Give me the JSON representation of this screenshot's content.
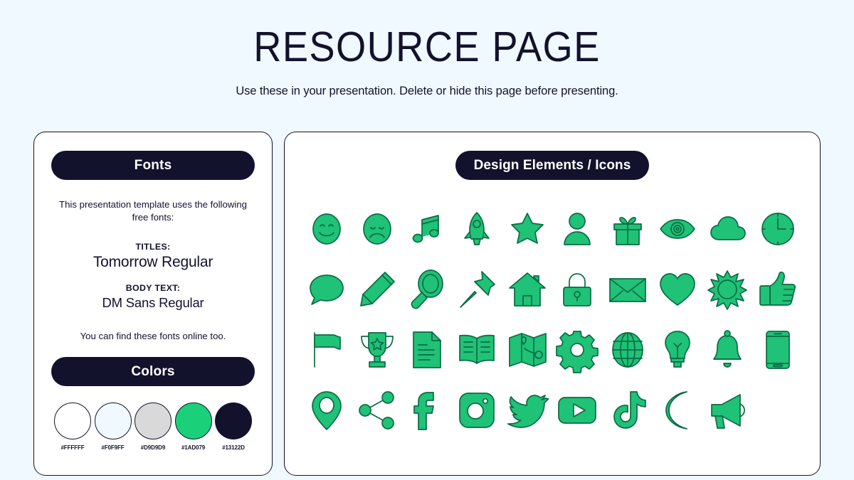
{
  "header": {
    "title": "RESOURCE PAGE",
    "subtitle": "Use these in your presentation. Delete or hide this page before presenting."
  },
  "fonts_panel": {
    "heading": "Fonts",
    "intro": "This presentation template uses the following free fonts:",
    "titles_label": "TITLES:",
    "titles_font": "Tomorrow Regular",
    "body_label": "BODY TEXT:",
    "body_font": "DM Sans Regular",
    "outro": "You can find these fonts online too."
  },
  "colors_panel": {
    "heading": "Colors",
    "swatches": [
      {
        "hex": "#FFFFFF",
        "label": "#FFFFFF",
        "bordered": true
      },
      {
        "hex": "#F0F9FF",
        "label": "#F0F9FF",
        "bordered": true
      },
      {
        "hex": "#D9D9D9",
        "label": "#D9D9D9",
        "bordered": true
      },
      {
        "hex": "#1AD079",
        "label": "#1AD079",
        "bordered": true
      },
      {
        "hex": "#13122D",
        "label": "#13122D",
        "bordered": false
      }
    ]
  },
  "icons_panel": {
    "heading": "Design Elements / Icons",
    "accent_color": "#1FC277",
    "outline_color": "#0B6B43",
    "icons": [
      {
        "name": "smiley-face-icon"
      },
      {
        "name": "sad-face-icon"
      },
      {
        "name": "music-note-icon"
      },
      {
        "name": "rocket-icon"
      },
      {
        "name": "star-icon"
      },
      {
        "name": "person-icon"
      },
      {
        "name": "gift-icon"
      },
      {
        "name": "eye-icon"
      },
      {
        "name": "cloud-icon"
      },
      {
        "name": "clock-icon"
      },
      {
        "name": "speech-bubble-icon"
      },
      {
        "name": "pencil-icon"
      },
      {
        "name": "magnifier-icon"
      },
      {
        "name": "pushpin-icon"
      },
      {
        "name": "house-icon"
      },
      {
        "name": "lock-icon"
      },
      {
        "name": "envelope-icon"
      },
      {
        "name": "heart-icon"
      },
      {
        "name": "sun-icon"
      },
      {
        "name": "thumbs-up-icon"
      },
      {
        "name": "flag-icon"
      },
      {
        "name": "trophy-icon"
      },
      {
        "name": "document-icon"
      },
      {
        "name": "book-icon"
      },
      {
        "name": "map-icon"
      },
      {
        "name": "gear-icon"
      },
      {
        "name": "globe-icon"
      },
      {
        "name": "lightbulb-icon"
      },
      {
        "name": "bell-icon"
      },
      {
        "name": "phone-icon"
      },
      {
        "name": "location-pin-icon"
      },
      {
        "name": "share-icon"
      },
      {
        "name": "facebook-icon"
      },
      {
        "name": "instagram-icon"
      },
      {
        "name": "twitter-icon"
      },
      {
        "name": "youtube-icon"
      },
      {
        "name": "tiktok-icon"
      },
      {
        "name": "moon-icon"
      },
      {
        "name": "megaphone-icon"
      }
    ]
  }
}
